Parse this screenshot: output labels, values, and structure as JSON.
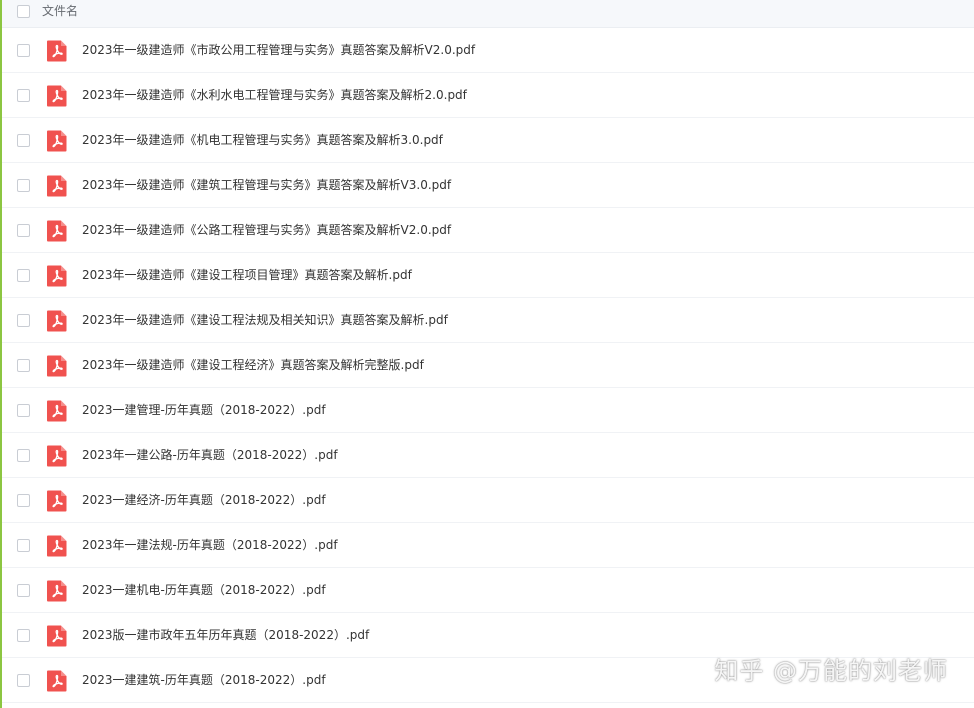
{
  "header": {
    "column_label": "文件名"
  },
  "files": [
    {
      "name": "2023年一级建造师《市政公用工程管理与实务》真题答案及解析V2.0.pdf"
    },
    {
      "name": "2023年一级建造师《水利水电工程管理与实务》真题答案及解析2.0.pdf"
    },
    {
      "name": "2023年一级建造师《机电工程管理与实务》真题答案及解析3.0.pdf"
    },
    {
      "name": "2023年一级建造师《建筑工程管理与实务》真题答案及解析V3.0.pdf"
    },
    {
      "name": "2023年一级建造师《公路工程管理与实务》真题答案及解析V2.0.pdf"
    },
    {
      "name": "2023年一级建造师《建设工程项目管理》真题答案及解析.pdf"
    },
    {
      "name": "2023年一级建造师《建设工程法规及相关知识》真题答案及解析.pdf"
    },
    {
      "name": "2023年一级建造师《建设工程经济》真题答案及解析完整版.pdf"
    },
    {
      "name": "2023一建管理-历年真题（2018-2022）.pdf"
    },
    {
      "name": "2023年一建公路-历年真题（2018-2022）.pdf"
    },
    {
      "name": "2023一建经济-历年真题（2018-2022）.pdf"
    },
    {
      "name": "2023年一建法规-历年真题（2018-2022）.pdf"
    },
    {
      "name": "2023一建机电-历年真题（2018-2022）.pdf"
    },
    {
      "name": "2023版一建市政年五年历年真题（2018-2022）.pdf"
    },
    {
      "name": "2023一建建筑-历年真题（2018-2022）.pdf"
    }
  ],
  "watermark": "知乎 @万能的刘老师",
  "colors": {
    "pdf_icon": "#f0524f",
    "left_accent": "#8cc641"
  },
  "icons": {
    "file_type": "pdf-icon"
  }
}
